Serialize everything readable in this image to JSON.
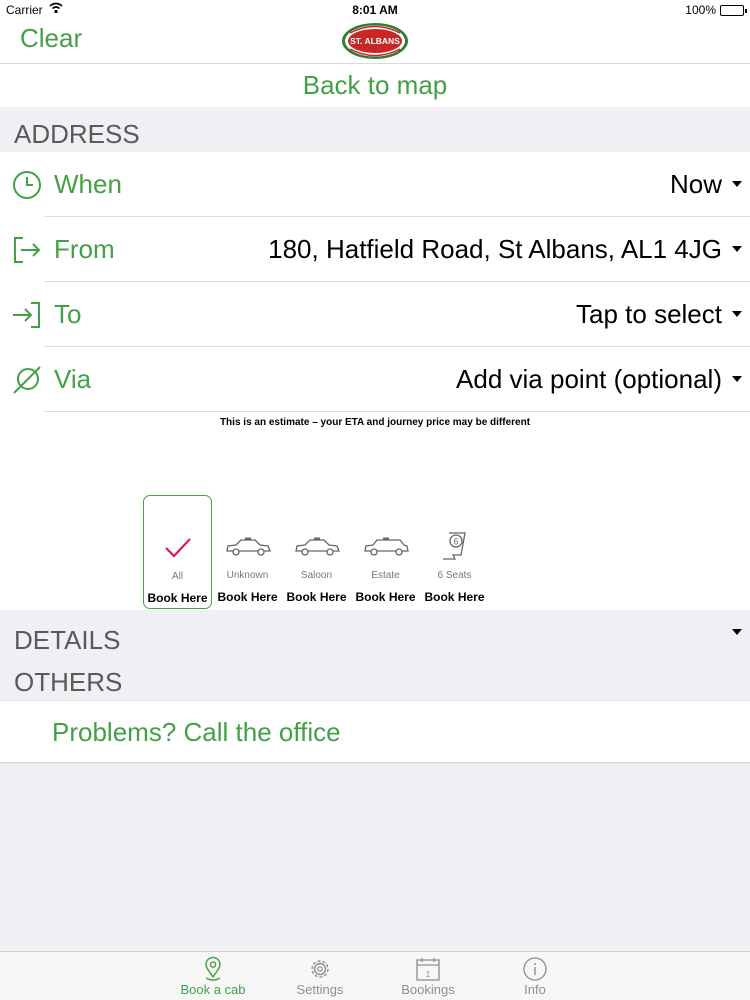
{
  "status_bar": {
    "carrier": "Carrier",
    "time": "8:01 AM",
    "battery": "100%"
  },
  "nav": {
    "clear_label": "Clear",
    "logo_text": "ST. ALBANS"
  },
  "back_to_map": "Back to map",
  "address_section": {
    "title": "ADDRESS",
    "rows": [
      {
        "label": "When",
        "value": "Now",
        "icon": "clock-icon"
      },
      {
        "label": "From",
        "value": "180, Hatfield Road, St Albans, AL1 4JG",
        "icon": "pickup-arrow-icon"
      },
      {
        "label": "To",
        "value": "Tap to select",
        "icon": "dropoff-arrow-icon"
      },
      {
        "label": "Via",
        "value": "Add via point (optional)",
        "icon": "via-point-icon"
      }
    ],
    "estimate_note": "This is an estimate – your ETA and journey price may be different"
  },
  "vehicles": [
    {
      "name": "All",
      "book": "Book Here",
      "icon": "check-icon",
      "selected": true
    },
    {
      "name": "Unknown",
      "book": "Book Here",
      "icon": "taxi-icon",
      "selected": false
    },
    {
      "name": "Saloon",
      "book": "Book Here",
      "icon": "saloon-car-icon",
      "selected": false
    },
    {
      "name": "Estate",
      "book": "Book Here",
      "icon": "estate-car-icon",
      "selected": false
    },
    {
      "name": "6 Seats",
      "book": "Book Here",
      "icon": "six-seat-icon",
      "selected": false
    }
  ],
  "details_section": {
    "title": "DETAILS"
  },
  "others_section": {
    "title": "OTHERS",
    "call_office": "Problems? Call the office"
  },
  "tabs": [
    {
      "label": "Book a cab",
      "icon": "map-pin-icon",
      "active": true
    },
    {
      "label": "Settings",
      "icon": "gear-icon",
      "active": false
    },
    {
      "label": "Bookings",
      "icon": "calendar-icon",
      "active": false
    },
    {
      "label": "Info",
      "icon": "info-icon",
      "active": false
    }
  ],
  "colors": {
    "accent": "#43a047",
    "background": "#efeff4",
    "check": "#d81b60"
  }
}
